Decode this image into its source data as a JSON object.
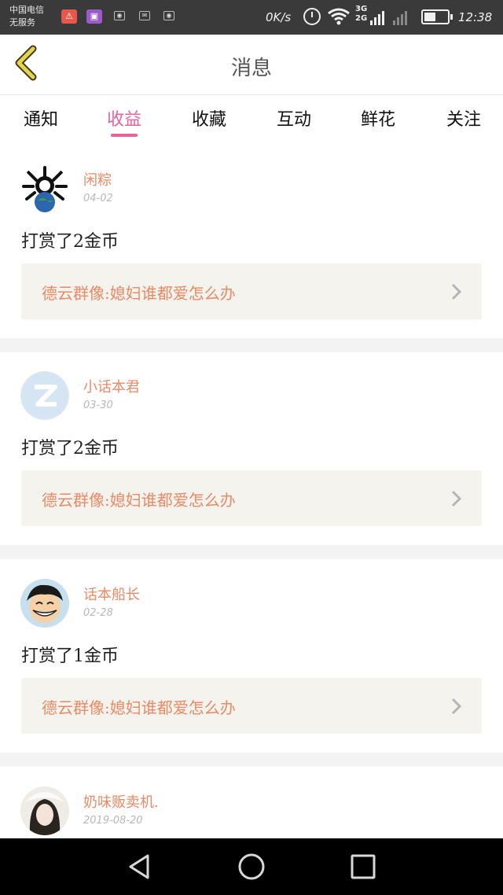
{
  "status_bar": {
    "carrier_line1": "中国电信",
    "carrier_line2": "无服务",
    "net_speed": "0K/s",
    "network_3g": "3G",
    "network_2g": "2G",
    "time": "12:38",
    "icons": [
      "warning-icon",
      "gallery-icon",
      "weibo-icon",
      "mail-icon",
      "weibo-icon",
      "alarm-icon",
      "wifi-icon",
      "signal-icon",
      "no-signal-icon",
      "battery-icon"
    ]
  },
  "header": {
    "title": "消息",
    "back_icon": "back-chevron-icon"
  },
  "tabs": [
    {
      "label": "通知",
      "active": false
    },
    {
      "label": "收益",
      "active": true
    },
    {
      "label": "收藏",
      "active": false
    },
    {
      "label": "互动",
      "active": false
    },
    {
      "label": "鲜花",
      "active": false
    },
    {
      "label": "关注",
      "active": false
    }
  ],
  "colors": {
    "accent_pink": "#e7639b",
    "username_orange": "#e88a66",
    "link_bg": "#f4f3ee"
  },
  "messages": [
    {
      "username": "闲粽",
      "date": "04-02",
      "text": "打赏了2金币",
      "link": "德云群像:媳妇谁都爱怎么办",
      "avatar": "skull-globe-avatar"
    },
    {
      "username": "小话本君",
      "date": "03-30",
      "text": "打赏了2金币",
      "link": "德云群像:媳妇谁都爱怎么办",
      "avatar": "default-z-avatar"
    },
    {
      "username": "话本船长",
      "date": "02-28",
      "text": "打赏了1金币",
      "link": "德云群像:媳妇谁都爱怎么办",
      "avatar": "cartoon-boy-avatar"
    },
    {
      "username": "奶味贩卖机.",
      "date": "2019-08-20",
      "avatar": "girl-photo-avatar"
    }
  ],
  "nav_bar": {
    "buttons": [
      "back-triangle-icon",
      "home-circle-icon",
      "recents-square-icon"
    ]
  }
}
